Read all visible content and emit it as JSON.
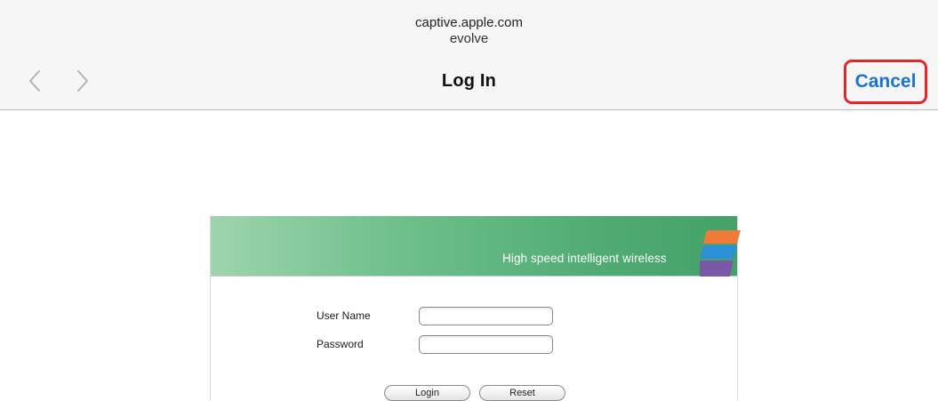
{
  "browser": {
    "host": "captive.apple.com",
    "network_name": "evolve",
    "page_title": "Log In",
    "cancel_label": "Cancel",
    "highlight_color": "#e4262b",
    "link_color": "#1a73d6",
    "back_icon": "chevron-left-icon",
    "forward_icon": "chevron-right-icon"
  },
  "portal": {
    "tagline": "High speed intelligent wireless",
    "banner_color": "#4fab72",
    "logo_colors": [
      "#f07a3a",
      "#2d8fd6",
      "#7a5aa8"
    ],
    "form": {
      "username_label": "User Name",
      "username_value": "",
      "password_label": "Password",
      "password_value": "",
      "login_label": "Login",
      "reset_label": "Reset"
    }
  }
}
